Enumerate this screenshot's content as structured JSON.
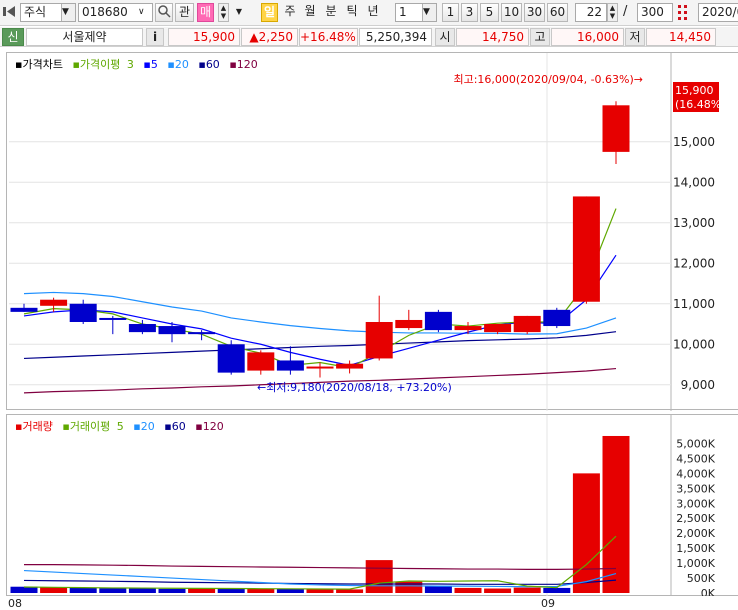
{
  "toolbar": {
    "market_type": "주식",
    "stock_code": "018680",
    "btn_watch": "관",
    "btn_ma": "매",
    "period_buttons": [
      "일",
      "주",
      "월",
      "분",
      "틱",
      "년"
    ],
    "interval_value": "1",
    "interval_buttons": [
      "1",
      "3",
      "5",
      "10",
      "30",
      "60"
    ],
    "count_value": "22",
    "separator": "/",
    "total_value": "300",
    "date_value": "2020/0"
  },
  "infobar": {
    "flag": "신",
    "stock_name": "서울제약",
    "info_button": "i",
    "price": "15,900",
    "change": "▲2,250",
    "change_pct": "+16.48%",
    "volume": "5,250,394",
    "open_label": "시",
    "open_value": "14,750",
    "high_label": "고",
    "high_value": "16,000",
    "low_label": "저",
    "low_value": "14,450"
  },
  "price_panel": {
    "legend_title": "가격차트",
    "legend_ma_title": "가격이평",
    "legend_periods": [
      "3",
      "5",
      "20",
      "60",
      "120"
    ],
    "high_annotation": "최고:16,000(2020/09/04, -0.63%)→",
    "low_annotation": "←최저:9,180(2020/08/18, +73.20%)",
    "current_price_tag": [
      "15,900",
      "(16.48%)"
    ]
  },
  "volume_panel": {
    "legend_title": "거래량",
    "legend_ma_title": "거래이평",
    "legend_periods": [
      "5",
      "20",
      "60",
      "120"
    ]
  },
  "x_axis_labels": [
    "08",
    "09"
  ],
  "colors": {
    "up": "#e60000",
    "down": "#0000cc",
    "ma3": "#5fa800",
    "ma5": "#0000ff",
    "ma20": "#1e90ff",
    "ma60": "#00008b",
    "ma120": "#800040"
  },
  "chart_data": [
    {
      "type": "candlestick",
      "title": "가격차트",
      "yticks": [
        9000,
        10000,
        11000,
        12000,
        13000,
        14000,
        15000,
        15900
      ],
      "ylim": [
        8550,
        16500
      ],
      "candles": [
        {
          "open": 10900,
          "high": 11000,
          "low": 10800,
          "close": 10800
        },
        {
          "open": 10950,
          "high": 11150,
          "low": 10800,
          "close": 11100
        },
        {
          "open": 11000,
          "high": 11100,
          "low": 10500,
          "close": 10550
        },
        {
          "open": 10650,
          "high": 10700,
          "low": 10250,
          "close": 10600
        },
        {
          "open": 10500,
          "high": 10600,
          "low": 10250,
          "close": 10300
        },
        {
          "open": 10450,
          "high": 10550,
          "low": 10050,
          "close": 10250
        },
        {
          "open": 10300,
          "high": 10350,
          "low": 10100,
          "close": 10250
        },
        {
          "open": 10000,
          "high": 10100,
          "low": 9250,
          "close": 9300
        },
        {
          "open": 9350,
          "high": 9850,
          "low": 9250,
          "close": 9800
        },
        {
          "open": 9600,
          "high": 9950,
          "low": 9250,
          "close": 9350
        },
        {
          "open": 9420,
          "high": 9550,
          "low": 9180,
          "close": 9450
        },
        {
          "open": 9400,
          "high": 9600,
          "low": 9280,
          "close": 9520
        },
        {
          "open": 9650,
          "high": 11200,
          "low": 9600,
          "close": 10550
        },
        {
          "open": 10400,
          "high": 10850,
          "low": 10350,
          "close": 10600
        },
        {
          "open": 10800,
          "high": 10850,
          "low": 10300,
          "close": 10350
        },
        {
          "open": 10350,
          "high": 10550,
          "low": 10250,
          "close": 10450
        },
        {
          "open": 10300,
          "high": 10500,
          "low": 10250,
          "close": 10500
        },
        {
          "open": 10300,
          "high": 10700,
          "low": 10250,
          "close": 10700
        },
        {
          "open": 10850,
          "high": 10900,
          "low": 10400,
          "close": 10450
        },
        {
          "open": 11050,
          "high": 13650,
          "low": 11000,
          "close": 13650
        },
        {
          "open": 14750,
          "high": 16000,
          "low": 14450,
          "close": 15900
        }
      ],
      "ma3": [
        10750,
        10880,
        10850,
        10750,
        10500,
        10380,
        10250,
        9950,
        9780,
        9480,
        9550,
        9420,
        9800,
        10220,
        10500,
        10450,
        10520,
        10550,
        10550,
        11500,
        13350
      ],
      "ma5": [
        10700,
        10800,
        10850,
        10800,
        10650,
        10500,
        10380,
        10150,
        10000,
        9800,
        9630,
        9480,
        9700,
        9900,
        10100,
        10300,
        10480,
        10550,
        10500,
        11100,
        12200
      ],
      "ma20": [
        11250,
        11280,
        11250,
        11180,
        11050,
        10920,
        10820,
        10650,
        10550,
        10460,
        10390,
        10330,
        10300,
        10280,
        10280,
        10270,
        10270,
        10250,
        10260,
        10400,
        10650
      ],
      "ma60": [
        9650,
        9680,
        9710,
        9740,
        9770,
        9800,
        9830,
        9860,
        9890,
        9920,
        9950,
        9970,
        10000,
        10030,
        10060,
        10090,
        10110,
        10130,
        10160,
        10220,
        10310
      ],
      "ma120": [
        8800,
        8830,
        8850,
        8870,
        8900,
        8920,
        8950,
        8970,
        9000,
        9030,
        9060,
        9090,
        9110,
        9140,
        9170,
        9200,
        9230,
        9260,
        9300,
        9340,
        9400
      ]
    },
    {
      "type": "bar",
      "title": "거래량",
      "yticks_labels": [
        "0K",
        "500K",
        "1,000K",
        "1,500K",
        "2,000K",
        "2,500K",
        "3,000K",
        "3,500K",
        "4,000K",
        "4,500K",
        "5,000K"
      ],
      "ylim": [
        0,
        5350000
      ],
      "values": [
        210000,
        200000,
        180000,
        160000,
        150000,
        140000,
        150000,
        160000,
        150000,
        140000,
        130000,
        120000,
        1100000,
        380000,
        250000,
        170000,
        150000,
        180000,
        170000,
        4000000,
        5250394
      ],
      "up": [
        false,
        true,
        false,
        false,
        false,
        false,
        true,
        false,
        true,
        false,
        true,
        true,
        true,
        true,
        false,
        true,
        true,
        true,
        false,
        true,
        true
      ],
      "ma5": [
        200000,
        190000,
        180000,
        170000,
        165000,
        160000,
        155000,
        150000,
        145000,
        140000,
        135000,
        130000,
        330000,
        400000,
        390000,
        400000,
        410000,
        230000,
        180000,
        950000,
        1900000
      ],
      "ma20": [
        750000,
        700000,
        650000,
        600000,
        550000,
        500000,
        450000,
        400000,
        350000,
        300000,
        270000,
        250000,
        240000,
        240000,
        230000,
        230000,
        220000,
        210000,
        220000,
        380000,
        650000
      ],
      "ma60": [
        420000,
        410000,
        400000,
        390000,
        380000,
        360000,
        350000,
        340000,
        330000,
        320000,
        310000,
        300000,
        300000,
        300000,
        300000,
        290000,
        290000,
        290000,
        290000,
        350000,
        430000
      ],
      "ma120": [
        950000,
        950000,
        940000,
        930000,
        920000,
        900000,
        890000,
        880000,
        870000,
        860000,
        850000,
        840000,
        830000,
        820000,
        810000,
        800000,
        800000,
        790000,
        790000,
        800000,
        820000
      ]
    }
  ]
}
